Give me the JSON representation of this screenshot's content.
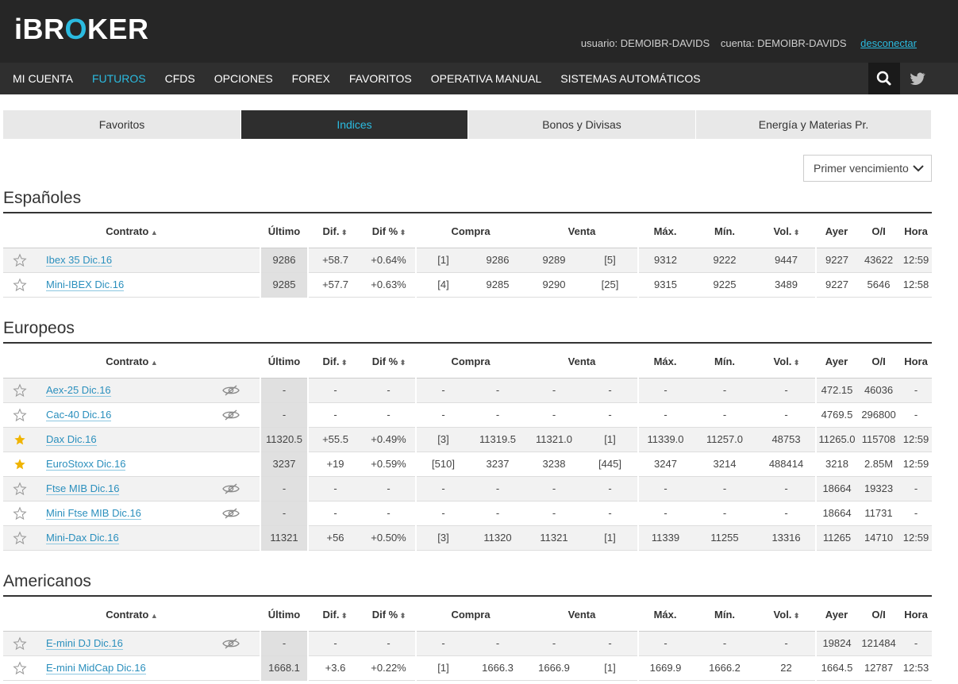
{
  "header": {
    "logo": {
      "pre": "iBR",
      "o": "O",
      "post": "KER"
    },
    "user_label": "usuario: DEMOIBR-DAVIDS",
    "account_label": "cuenta: DEMOIBR-DAVIDS",
    "logout": "desconectar"
  },
  "nav": {
    "items": [
      "MI CUENTA",
      "FUTUROS",
      "CFDS",
      "OPCIONES",
      "FOREX",
      "FAVORITOS",
      "OPERATIVA MANUAL",
      "SISTEMAS AUTOMÁTICOS"
    ],
    "active": "FUTUROS",
    "search_icon": "search-icon",
    "twitter_icon": "twitter-icon"
  },
  "tabs": [
    {
      "label": "Favoritos",
      "active": false
    },
    {
      "label": "Indices",
      "active": true
    },
    {
      "label": "Bonos y Divisas",
      "active": false
    },
    {
      "label": "Energía y Materias Pr.",
      "active": false
    }
  ],
  "expiry_select": {
    "value": "Primer vencimiento"
  },
  "columns": {
    "contract": "Contrato",
    "last": "Último",
    "dif": "Dif.",
    "difpct": "Dif %",
    "buy": "Compra",
    "sell": "Venta",
    "max": "Máx.",
    "min": "Mín.",
    "vol": "Vol.",
    "prev": "Ayer",
    "oi": "O/I",
    "time": "Hora"
  },
  "colors": {
    "accent": "#2bbbe0",
    "positive": "#1e9a4a",
    "star": "#f0b400",
    "header_bg": "#262626"
  },
  "sections": [
    {
      "title": "Españoles",
      "rows": [
        {
          "fav": false,
          "hidden": false,
          "name": "Ibex 35 Dic.16",
          "last": "9286",
          "dif": "+58.7",
          "difpct": "+0.64%",
          "bq": "[1]",
          "bid": "9286",
          "ask": "9289",
          "aq": "[5]",
          "max": "9312",
          "min": "9222",
          "vol": "9447",
          "prev": "9227",
          "oi": "43622",
          "time": "12:59"
        },
        {
          "fav": false,
          "hidden": false,
          "name": "Mini-IBEX Dic.16",
          "last": "9285",
          "dif": "+57.7",
          "difpct": "+0.63%",
          "bq": "[4]",
          "bid": "9285",
          "ask": "9290",
          "aq": "[25]",
          "max": "9315",
          "min": "9225",
          "vol": "3489",
          "prev": "9227",
          "oi": "5646",
          "time": "12:58"
        }
      ]
    },
    {
      "title": "Europeos",
      "rows": [
        {
          "fav": false,
          "hidden": true,
          "name": "Aex-25 Dic.16",
          "last": "-",
          "dif": "-",
          "difpct": "-",
          "bq": "-",
          "bid": "-",
          "ask": "-",
          "aq": "-",
          "max": "-",
          "min": "-",
          "vol": "-",
          "prev": "472.15",
          "oi": "46036",
          "time": "-"
        },
        {
          "fav": false,
          "hidden": true,
          "name": "Cac-40 Dic.16",
          "last": "-",
          "dif": "-",
          "difpct": "-",
          "bq": "-",
          "bid": "-",
          "ask": "-",
          "aq": "-",
          "max": "-",
          "min": "-",
          "vol": "-",
          "prev": "4769.5",
          "oi": "296800",
          "time": "-"
        },
        {
          "fav": true,
          "hidden": false,
          "name": "Dax Dic.16",
          "last": "11320.5",
          "dif": "+55.5",
          "difpct": "+0.49%",
          "bq": "[3]",
          "bid": "11319.5",
          "ask": "11321.0",
          "aq": "[1]",
          "max": "11339.0",
          "min": "11257.0",
          "vol": "48753",
          "prev": "11265.0",
          "oi": "115708",
          "time": "12:59"
        },
        {
          "fav": true,
          "hidden": false,
          "name": "EuroStoxx Dic.16",
          "last": "3237",
          "dif": "+19",
          "difpct": "+0.59%",
          "bq": "[510]",
          "bid": "3237",
          "ask": "3238",
          "aq": "[445]",
          "max": "3247",
          "min": "3214",
          "vol": "488414",
          "prev": "3218",
          "oi": "2.85M",
          "time": "12:59"
        },
        {
          "fav": false,
          "hidden": true,
          "name": "Ftse MIB Dic.16",
          "last": "-",
          "dif": "-",
          "difpct": "-",
          "bq": "-",
          "bid": "-",
          "ask": "-",
          "aq": "-",
          "max": "-",
          "min": "-",
          "vol": "-",
          "prev": "18664",
          "oi": "19323",
          "time": "-"
        },
        {
          "fav": false,
          "hidden": true,
          "name": "Mini Ftse MIB Dic.16",
          "last": "-",
          "dif": "-",
          "difpct": "-",
          "bq": "-",
          "bid": "-",
          "ask": "-",
          "aq": "-",
          "max": "-",
          "min": "-",
          "vol": "-",
          "prev": "18664",
          "oi": "11731",
          "time": "-"
        },
        {
          "fav": false,
          "hidden": false,
          "name": "Mini-Dax Dic.16",
          "last": "11321",
          "dif": "+56",
          "difpct": "+0.50%",
          "bq": "[3]",
          "bid": "11320",
          "ask": "11321",
          "aq": "[1]",
          "max": "11339",
          "min": "11255",
          "vol": "13316",
          "prev": "11265",
          "oi": "14710",
          "time": "12:59"
        }
      ]
    },
    {
      "title": "Americanos",
      "rows": [
        {
          "fav": false,
          "hidden": true,
          "name": "E-mini DJ Dic.16",
          "last": "-",
          "dif": "-",
          "difpct": "-",
          "bq": "-",
          "bid": "-",
          "ask": "-",
          "aq": "-",
          "max": "-",
          "min": "-",
          "vol": "-",
          "prev": "19824",
          "oi": "121484",
          "time": "-"
        },
        {
          "fav": false,
          "hidden": false,
          "name": "E-mini MidCap Dic.16",
          "last": "1668.1",
          "dif": "+3.6",
          "difpct": "+0.22%",
          "bq": "[1]",
          "bid": "1666.3",
          "ask": "1666.9",
          "aq": "[1]",
          "max": "1669.9",
          "min": "1666.2",
          "vol": "22",
          "prev": "1664.5",
          "oi": "12787",
          "time": "12:53"
        }
      ]
    }
  ]
}
